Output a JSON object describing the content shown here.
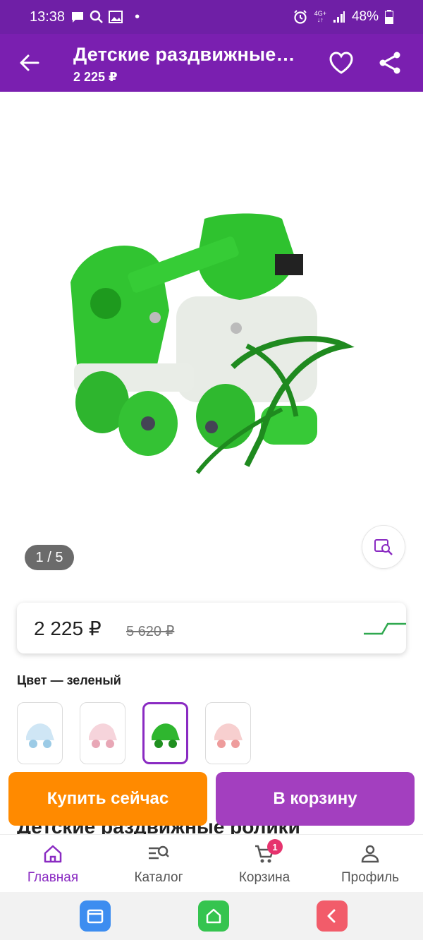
{
  "status_bar": {
    "time": "13:38",
    "network": "4G+",
    "battery": "48%"
  },
  "app_bar": {
    "title": "Детские раздвижные…",
    "subtitle": "2 225 ₽"
  },
  "gallery": {
    "counter": "1 / 5"
  },
  "price": {
    "current": "2 225 ₽",
    "old": "5 620 ₽"
  },
  "color": {
    "label": "Цвет — зеленый",
    "swatches": [
      {
        "color_hex": "#cfe6f5",
        "accent_hex": "#9ccbe6",
        "selected": false
      },
      {
        "color_hex": "#f6d4db",
        "accent_hex": "#e8a7b6",
        "selected": false
      },
      {
        "color_hex": "#2fb62f",
        "accent_hex": "#1f8f1f",
        "selected": true
      },
      {
        "color_hex": "#f7cfcf",
        "accent_hex": "#ee9c9c",
        "selected": false
      }
    ]
  },
  "description": {
    "title": "Детские раздвижные ролики"
  },
  "actions": {
    "buy_now": "Купить сейчас",
    "to_cart": "В корзину"
  },
  "bottom_nav": {
    "home": "Главная",
    "catalog": "Каталог",
    "cart": "Корзина",
    "cart_badge": "1",
    "profile": "Профиль"
  },
  "colors": {
    "primary": "#7a1fb0",
    "accent_orange": "#ff8a00",
    "accent_purple": "#a33fbf",
    "price_trend": "#2fa84f"
  }
}
